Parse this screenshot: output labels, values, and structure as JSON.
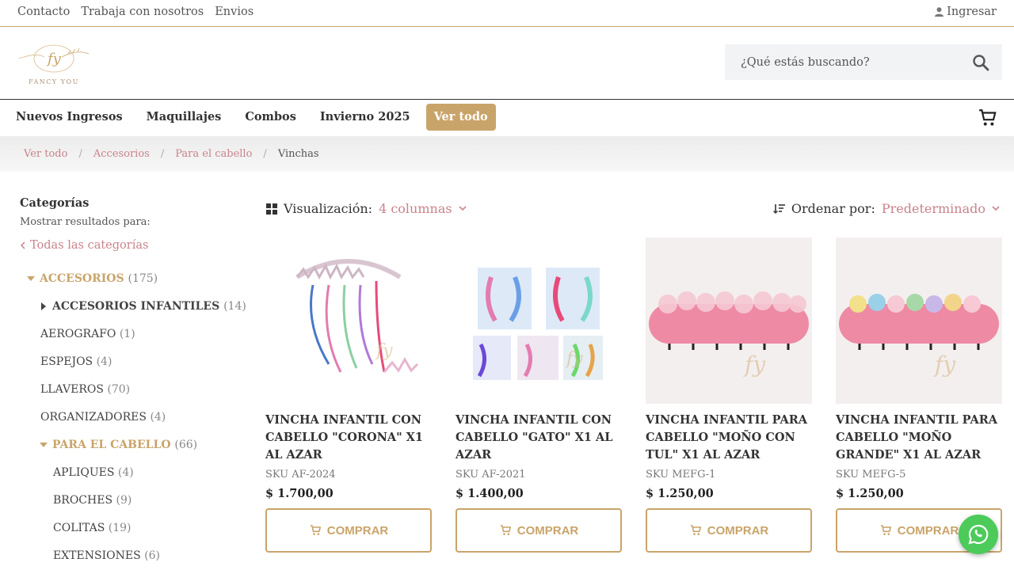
{
  "topbar": {
    "links": [
      "Contacto",
      "Trabaja con nosotros",
      "Envios"
    ],
    "login": "Ingresar"
  },
  "header": {
    "logo_text": "FANCY YOU",
    "search_placeholder": "¿Qué estás buscando?"
  },
  "nav": {
    "items": [
      "Nuevos Ingresos",
      "Maquillajes",
      "Combos",
      "Invierno 2025",
      "Ver todo"
    ],
    "active": "Ver todo"
  },
  "breadcrumb": [
    "Ver todo",
    "Accesorios",
    "Para el cabello",
    "Vinchas"
  ],
  "sidebar": {
    "title": "Categorías",
    "subtitle": "Mostrar resultados para:",
    "all_link": "Todas las categorías",
    "categories": [
      {
        "label": "ACCESORIOS",
        "count": "(175)"
      },
      {
        "label": "ACCESORIOS INFANTILES",
        "count": "(14)"
      },
      {
        "label": "AEROGRAFO",
        "count": "(1)"
      },
      {
        "label": "ESPEJOS",
        "count": "(4)"
      },
      {
        "label": "LLAVEROS",
        "count": "(70)"
      },
      {
        "label": "ORGANIZADORES",
        "count": "(4)"
      },
      {
        "label": "PARA EL CABELLO",
        "count": "(66)"
      },
      {
        "label": "APLIQUES",
        "count": "(4)"
      },
      {
        "label": "BROCHES",
        "count": "(9)"
      },
      {
        "label": "COLITAS",
        "count": "(19)"
      },
      {
        "label": "EXTENSIONES",
        "count": "(6)"
      }
    ]
  },
  "toolbar": {
    "view_label": "Visualización:",
    "view_value": "4 columnas",
    "sort_label": "Ordenar por:",
    "sort_value": "Predeterminado"
  },
  "products": [
    {
      "name": "VINCHA INFANTIL CON CABELLO \"CORONA\" X1 AL AZAR",
      "sku": "SKU AF-2024",
      "price": "$  1.700,00",
      "buy": "COMPRAR"
    },
    {
      "name": "VINCHA INFANTIL CON CABELLO \"GATO\" X1 AL AZAR",
      "sku": "SKU AF-2021",
      "price": "$  1.400,00",
      "buy": "COMPRAR"
    },
    {
      "name": "VINCHA INFANTIL PARA CABELLO \"MOÑO CON TUL\" X1 AL AZAR",
      "sku": "SKU MEFG-1",
      "price": "$  1.250,00",
      "buy": "COMPRAR"
    },
    {
      "name": "VINCHA INFANTIL PARA CABELLO \"MOÑO GRANDE\" X1 AL AZAR",
      "sku": "SKU MEFG-5",
      "price": "$  1.250,00",
      "buy": "COMPRAR"
    }
  ],
  "colors": {
    "accent_gold": "#c9a46a",
    "link_rose": "#c9838b",
    "whatsapp": "#4ccb5a"
  },
  "icons": [
    "user-icon",
    "search-icon",
    "cart-icon",
    "grid-icon",
    "sort-icon",
    "chevron-down-icon",
    "chevron-left-icon",
    "whatsapp-icon"
  ]
}
